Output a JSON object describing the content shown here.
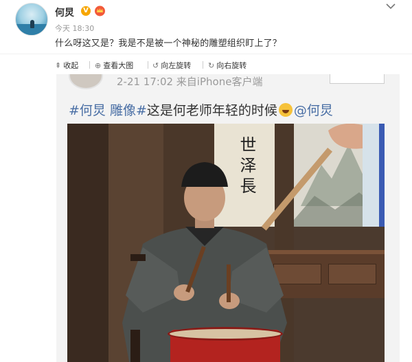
{
  "post": {
    "username": "何炅",
    "verified_badge": "V",
    "time": "今天 18:30",
    "text": "什么呀这又是？我是不是被一个神秘的雕塑组织盯上了？"
  },
  "actions": [
    {
      "icon": "collapse-icon",
      "glyph": "⇞",
      "label": "收起"
    },
    {
      "icon": "zoom-in-icon",
      "glyph": "⊕",
      "label": "查看大图"
    },
    {
      "icon": "rotate-left-icon",
      "glyph": "↺",
      "label": "向左旋转"
    },
    {
      "icon": "rotate-right-icon",
      "glyph": "↻",
      "label": "向右旋转"
    }
  ],
  "embedded": {
    "post_meta": "2-21 17:02  来自iPhone客户端",
    "tag1": "#何炅 雕像#",
    "caption": "这是何老师年轻的时候",
    "mention": "@何炅",
    "calligraphy": "世泽長"
  },
  "colors": {
    "accent": "#4a6fa5",
    "muted": "#999999",
    "text": "#333333"
  }
}
